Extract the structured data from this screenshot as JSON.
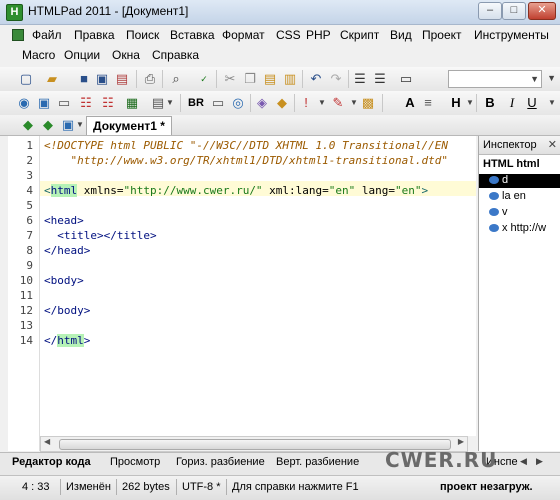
{
  "window": {
    "title": "HTMLPad 2011 - [Документ1]",
    "app_icon_letter": "H",
    "min_glyph": "–",
    "max_glyph": "□",
    "close_glyph": "✕"
  },
  "menu": {
    "row1": [
      "Файл",
      "Правка",
      "Поиск",
      "Вставка",
      "Формат",
      "CSS",
      "PHP",
      "Скрипт",
      "Вид",
      "Проект",
      "Инструменты"
    ],
    "row2": [
      "Macro",
      "Опции",
      "Окна",
      "Справка"
    ]
  },
  "toolbar": {
    "format_buttons": [
      "BR",
      "B",
      "I",
      "U",
      "H"
    ],
    "icons": [
      "new-file-icon",
      "open-folder-icon",
      "save-icon",
      "save-all-icon",
      "print-icon",
      "find-icon",
      "spellcheck-icon",
      "cut-icon",
      "copy-icon",
      "paste-icon",
      "undo-icon",
      "redo-icon",
      "indent-icon",
      "outdent-icon",
      "image-icon",
      "table-icon",
      "form-icon",
      "list-icon",
      "anchor-icon",
      "color-picker-icon"
    ]
  },
  "tabs": {
    "document": "Документ1 *"
  },
  "editor": {
    "line_numbers": [
      "1",
      "2",
      "3",
      "4",
      "5",
      "6",
      "7",
      "8",
      "9",
      "10",
      "11",
      "12",
      "13",
      "14"
    ],
    "lines": {
      "l1": "<!DOCTYPE html PUBLIC \"-//W3C//DTD XHTML 1.0 Transitional//EN",
      "l2": "    \"http://www.w3.org/TR/xhtml1/DTD/xhtml1-transitional.dtd\"",
      "l4_open": "<",
      "l4_tag": "html",
      "l4_rest_attr1": " xmlns=",
      "l4_val1": "\"http://www.cwer.ru/\"",
      "l4_attr2": " xml:lang=",
      "l4_val2": "\"en\"",
      "l4_attr3": " lang=",
      "l4_val3": "\"en\"",
      "l4_close": ">",
      "l6": "<head>",
      "l7": "  <title></title>",
      "l8": "</head>",
      "l10": "<body>",
      "l12": "</body>",
      "l14_open": "</",
      "l14_tag": "html",
      "l14_close": ">"
    }
  },
  "inspector": {
    "title": "Инспектор",
    "close_glyph": "✕",
    "section": "HTML html",
    "items": [
      "d",
      "la en",
      "v",
      "x http://w"
    ]
  },
  "bottom_tabs": [
    "Редактор кода",
    "Просмотр",
    "Гориз. разбиение",
    "Верт. разбиение"
  ],
  "bottom_tab_right": "Инспе",
  "watermark": "CWER.RU",
  "status": {
    "position": "4 : 33",
    "modified": "Изменён",
    "size": "262 bytes",
    "encoding": "UTF-8 *",
    "help": "Для справки нажмите F1",
    "loading": "проект незагруж."
  }
}
